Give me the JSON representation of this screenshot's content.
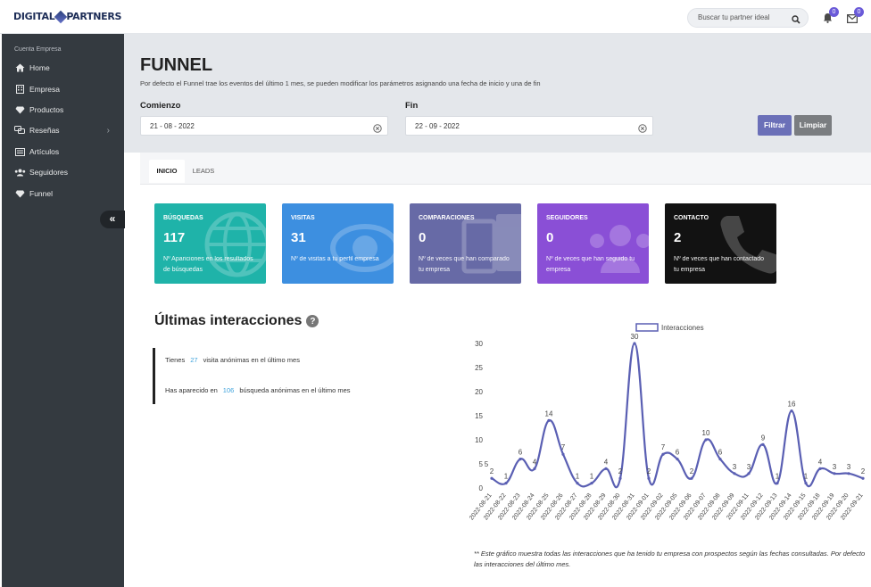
{
  "app": {
    "logo_left": "DIGITAL",
    "logo_right": "PARTNERS",
    "search_placeholder": "Buscar tu partner ideal",
    "notifications_count": "0",
    "messages_count": "0"
  },
  "sidebar": {
    "header": "Cuenta Empresa",
    "items": [
      {
        "label": "Home",
        "icon": "home-icon"
      },
      {
        "label": "Empresa",
        "icon": "building-icon"
      },
      {
        "label": "Productos",
        "icon": "diamond-icon"
      },
      {
        "label": "Reseñas",
        "icon": "comments-icon",
        "has_submenu": true
      },
      {
        "label": "Artículos",
        "icon": "newspaper-icon"
      },
      {
        "label": "Seguidores",
        "icon": "users-icon"
      },
      {
        "label": "Funnel",
        "icon": "diamond-icon"
      }
    ],
    "collapse_label": "«"
  },
  "header": {
    "title": "FUNNEL",
    "description": "Por defecto el Funnel trae los eventos del último 1 mes, se pueden modificar los parámetros asignando una fecha de inicio y una de fin",
    "start_label": "Comienzo",
    "start_value": "21 - 08 - 2022",
    "end_label": "Fin",
    "end_value": "22 - 09 - 2022",
    "filter_button": "Filtrar",
    "clear_button": "Limpiar",
    "filter_color": "#6b70b8",
    "clear_color": "#7a7d80"
  },
  "tabs": [
    {
      "label": "INICIO",
      "active": true
    },
    {
      "label": "LEADS",
      "active": false
    }
  ],
  "cards": [
    {
      "title": "BÚSQUEDAS",
      "value": "117",
      "description": "Nº Apariciones en los resultados de búsquedas",
      "color": "#1fb3a9",
      "icon": "globe-icon"
    },
    {
      "title": "VISITAS",
      "value": "31",
      "description": "Nº de visitas a tu perfil empresa",
      "color": "#3d8fe0",
      "icon": "eye-icon"
    },
    {
      "title": "COMPARACIONES",
      "value": "0",
      "description": "Nº de veces que han comparado tu empresa",
      "color": "#676aa6",
      "icon": "compare-icon"
    },
    {
      "title": "SEGUIDORES",
      "value": "0",
      "description": "Nº de veces que han seguido tu empresa",
      "color": "#8a4fd6",
      "icon": "users-icon"
    },
    {
      "title": "CONTACTO",
      "value": "2",
      "description": "Nº de veces que han contactado tu empresa",
      "color": "#121212",
      "icon": "phone-icon"
    }
  ],
  "interactions": {
    "title": "Últimas interacciones",
    "visits_prefix": "Tienes",
    "visits_value": "27",
    "visits_suffix": "visita anónimas en el último mes",
    "search_prefix": "Has aparecido en",
    "search_value": "106",
    "search_suffix": "búsqueda anónimas en el último mes",
    "footnote_line1": "** Este gráfico muestra todas las interacciones que ha tenido tu empresa con prospectos según las fechas consultadas. Por defecto",
    "footnote_line2": "las interacciones del último mes."
  },
  "chart_data": {
    "type": "line",
    "x": [
      "2022-08-21",
      "2022-08-22",
      "2022-08-23",
      "2022-08-24",
      "2022-08-25",
      "2022-08-26",
      "2022-08-27",
      "2022-08-28",
      "2022-08-29",
      "2022-08-30",
      "2022-08-31",
      "2022-09-01",
      "2022-09-02",
      "2022-09-05",
      "2022-09-06",
      "2022-09-07",
      "2022-09-08",
      "2022-09-09",
      "2022-09-11",
      "2022-09-12",
      "2022-09-13",
      "2022-09-14",
      "2022-09-15",
      "2022-09-18",
      "2022-09-19",
      "2022-09-20",
      "2022-09-21"
    ],
    "series": [
      {
        "name": "Interacciones",
        "values": [
          2,
          1,
          6,
          4,
          14,
          7,
          1,
          1,
          4,
          2,
          30,
          2,
          7,
          6,
          2,
          10,
          6,
          3,
          3,
          9,
          1,
          16,
          1,
          4,
          3,
          3,
          2
        ],
        "color": "#5a5fb3"
      }
    ],
    "data_labels": [
      "2",
      "1",
      "6",
      "4",
      "14",
      "7",
      "1",
      "1",
      "4",
      "2",
      "30",
      "2",
      "7",
      "6",
      "2",
      "10",
      "6",
      "3",
      "3",
      "9",
      "1",
      "16",
      "1",
      "4",
      "3",
      "3",
      "2"
    ],
    "extra_label": "5",
    "yticks": [
      "0",
      "5",
      "10",
      "15",
      "20",
      "25",
      "30"
    ],
    "ylim": [
      0,
      30
    ],
    "legend": "top-center",
    "grid": false
  }
}
